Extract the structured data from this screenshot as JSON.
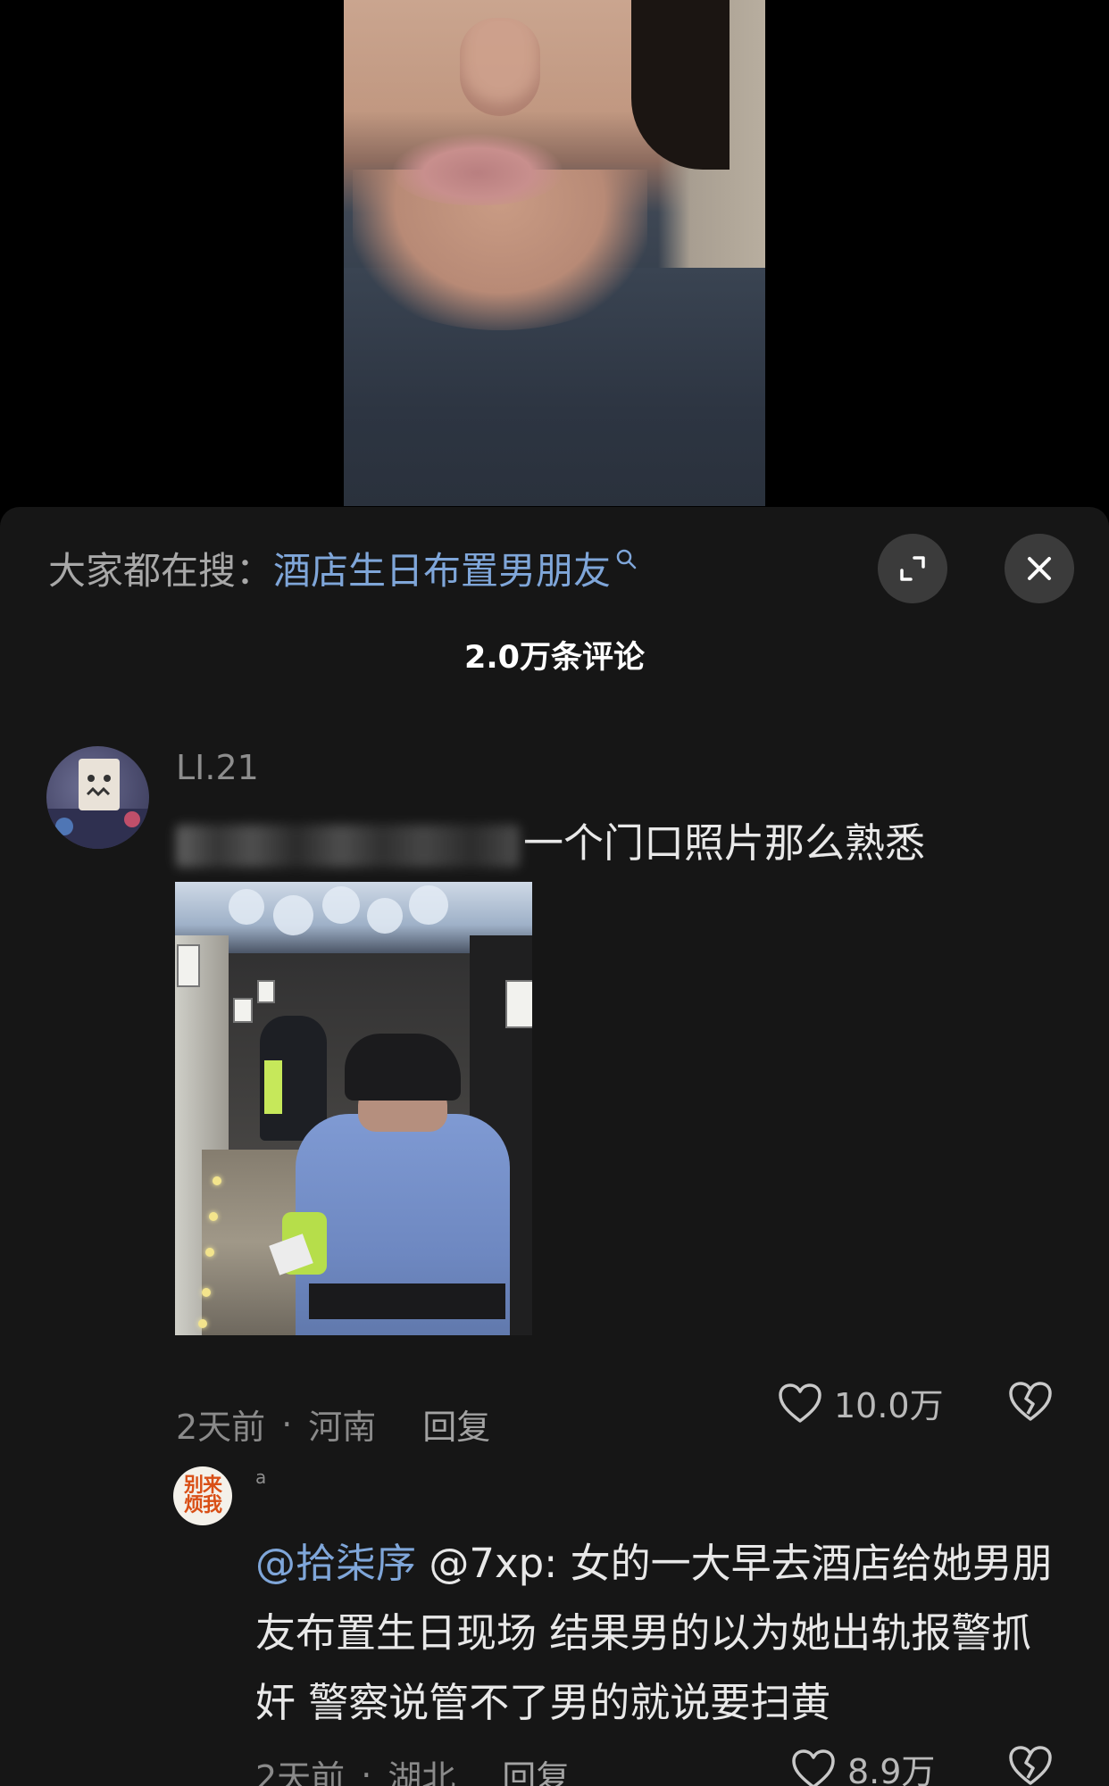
{
  "search": {
    "prefix": "大家都在搜：",
    "term": "酒店生日布置男朋友"
  },
  "comments_header": {
    "count_label": "2.0万条评论"
  },
  "comment": {
    "username": "LI.21",
    "text": "一个门口照片那么熟悉",
    "time": "2天前",
    "location": "河南",
    "reply_label": "回复",
    "likes": "10.0万"
  },
  "reply": {
    "avatar_text_line1": "别来",
    "avatar_text_line2": "烦我",
    "username": "a",
    "mention": "@拾柒序",
    "text": " @7xp: 女的一大早去酒店给她男朋友布置生日现场 结果男的以为她出轨报警抓奸 警察说管不了男的就说要扫黄",
    "time": "2天前",
    "location": "湖北",
    "reply_label": "回复",
    "likes": "8.9万"
  },
  "colors": {
    "sheet_bg": "#161616",
    "link_blue": "#7fa6d9",
    "muted": "#8a8a8a"
  },
  "icons": [
    "search-icon",
    "expand-icon",
    "close-icon",
    "heart-icon",
    "broken-heart-icon"
  ]
}
